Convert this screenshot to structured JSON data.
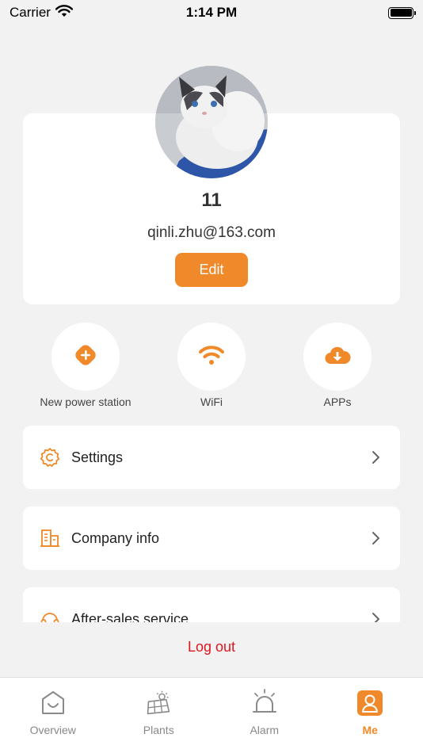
{
  "status_bar": {
    "carrier": "Carrier",
    "time": "1:14 PM"
  },
  "profile": {
    "username": "11",
    "email": "qinli.zhu@163.com",
    "edit_label": "Edit"
  },
  "quick_actions": [
    {
      "label": "New power station",
      "icon": "plus-diamond-icon"
    },
    {
      "label": "WiFi",
      "icon": "wifi-icon"
    },
    {
      "label": "APPs",
      "icon": "cloud-download-icon"
    }
  ],
  "menu": {
    "items": [
      {
        "label": "Settings",
        "icon": "gear-icon"
      },
      {
        "label": "Company info",
        "icon": "building-icon"
      },
      {
        "label": "After-sales service",
        "icon": "headset-icon"
      }
    ]
  },
  "logout_label": "Log out",
  "tabs": [
    {
      "label": "Overview",
      "icon": "home-icon",
      "active": false
    },
    {
      "label": "Plants",
      "icon": "solar-panel-icon",
      "active": false
    },
    {
      "label": "Alarm",
      "icon": "alarm-light-icon",
      "active": false
    },
    {
      "label": "Me",
      "icon": "person-icon",
      "active": true
    }
  ],
  "colors": {
    "accent": "#f0892a",
    "logout": "#e0161c",
    "background": "#f2f2f2"
  }
}
